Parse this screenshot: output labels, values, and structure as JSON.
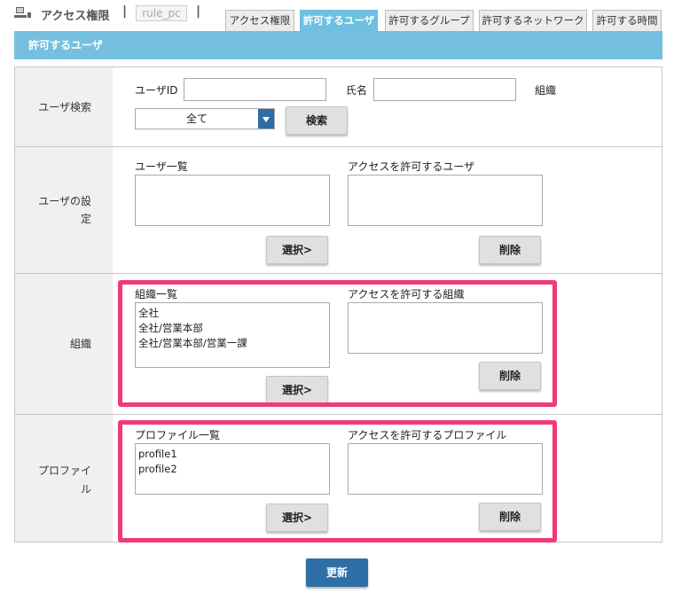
{
  "header": {
    "app_title": "アクセス権限",
    "separator": "|",
    "rule_name": "rule_pc",
    "icon": "computer-icon"
  },
  "tabs": [
    {
      "label": "アクセス権限",
      "active": false
    },
    {
      "label": "許可するユーザ",
      "active": true
    },
    {
      "label": "許可するグループ",
      "active": false
    },
    {
      "label": "許可するネットワーク",
      "active": false
    },
    {
      "label": "許可する時間",
      "active": false
    }
  ],
  "section_title": "許可するユーザ",
  "user_search": {
    "row_label": "ユーザ検索",
    "user_id_label": "ユーザID",
    "user_id_value": "",
    "name_label": "氏名",
    "name_value": "",
    "org_label": "組織",
    "org_select_value": "全て",
    "search_button": "検索"
  },
  "user_settings": {
    "row_label_line1": "ユーザの設",
    "row_label_line2": "定",
    "list_label": "ユーザ一覧",
    "allowed_label": "アクセスを許可するユーザ",
    "select_button": "選択>",
    "delete_button": "削除"
  },
  "organization": {
    "row_label": "組織",
    "list_label": "組織一覧",
    "items": [
      "全社",
      "全社/営業本部",
      "全社/営業本部/営業一課"
    ],
    "allowed_label": "アクセスを許可する組織",
    "select_button": "選択>",
    "delete_button": "削除"
  },
  "profile": {
    "row_label_line1": "プロファイ",
    "row_label_line2": "ル",
    "list_label": "プロファイル一覧",
    "items": [
      "profile1",
      "profile2"
    ],
    "allowed_label": "アクセスを許可するプロファイル",
    "select_button": "選択>",
    "delete_button": "削除"
  },
  "update_button": "更新",
  "colors": {
    "header_blue": "#75c0e0",
    "primary_button": "#2f6fa8",
    "highlight_pink": "#f23a74"
  }
}
